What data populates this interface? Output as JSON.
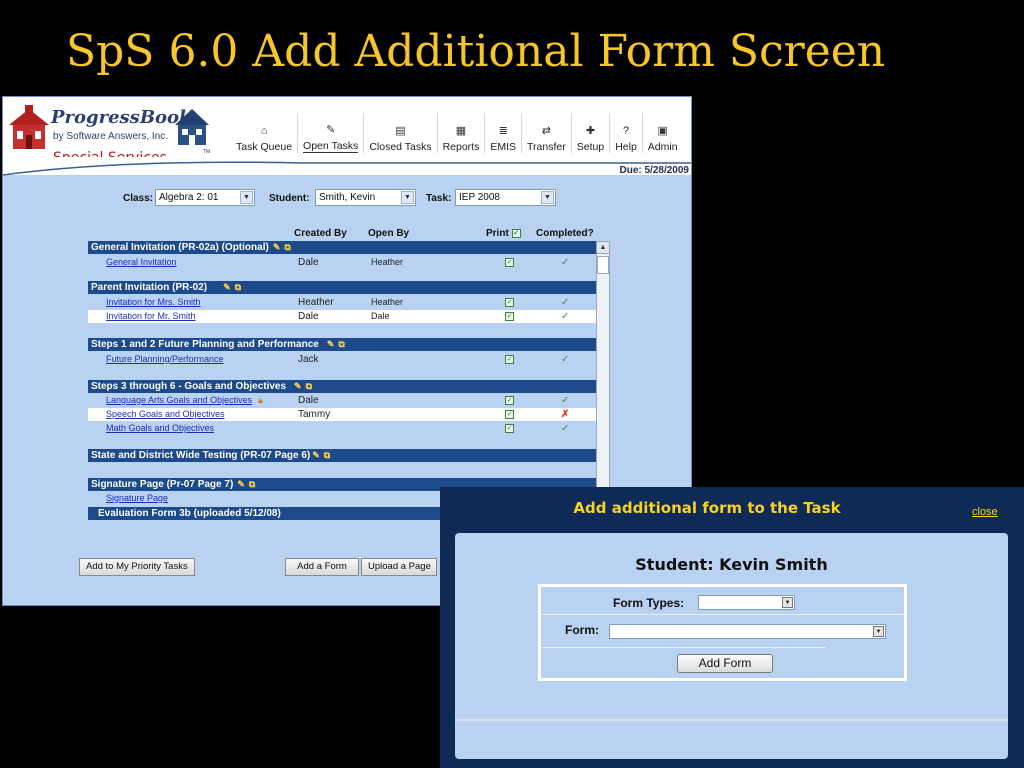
{
  "slide": {
    "title": "SpS 6.0 Add Additional Form Screen"
  },
  "app": {
    "logo": {
      "name": "ProgressBook",
      "sub": "by Software Answers, Inc.",
      "module": "Special Services",
      "tm": "TM"
    },
    "toolbar": [
      {
        "label": "Task Queue",
        "icon": "home-icon",
        "glyph": "⌂"
      },
      {
        "label": "Open Tasks",
        "icon": "edit-icon",
        "glyph": "✎"
      },
      {
        "label": "Closed Tasks",
        "icon": "closed-tasks-icon",
        "glyph": "▤"
      },
      {
        "label": "Reports",
        "icon": "reports-icon",
        "glyph": "▦"
      },
      {
        "label": "EMIS",
        "icon": "emis-icon",
        "glyph": "≣"
      },
      {
        "label": "Transfer",
        "icon": "transfer-icon",
        "glyph": "⇄"
      },
      {
        "label": "Setup",
        "icon": "setup-icon",
        "glyph": "✚"
      },
      {
        "label": "Help",
        "icon": "help-icon",
        "glyph": "?"
      },
      {
        "label": "Admin",
        "icon": "admin-icon",
        "glyph": "▣"
      }
    ],
    "due": "Due: 5/28/2009",
    "filters": {
      "class_label": "Class:",
      "class_value": "Algebra 2: 01",
      "student_label": "Student:",
      "student_value": "Smith, Kevin",
      "task_label": "Task:",
      "task_value": "IEP 2008"
    },
    "columns": {
      "created_by": "Created By",
      "open_by": "Open By",
      "print": "Print",
      "completed": "Completed?"
    },
    "sections": [
      {
        "title": "General Invitation (PR-02a)  (Optional)",
        "rows": [
          {
            "name": "General Invitation",
            "created_by": "Dale",
            "open_by": "Heather",
            "printed": true,
            "completed": "✓"
          }
        ]
      },
      {
        "title": "Parent Invitation (PR-02)",
        "rows": [
          {
            "name": "Invitation for Mrs. Smith",
            "created_by": "Heather",
            "open_by": "Heather",
            "printed": true,
            "completed": "✓"
          },
          {
            "name": "Invitation for Mr. Smith",
            "created_by": "Dale",
            "open_by": "Dale",
            "printed": true,
            "completed": "✓"
          }
        ]
      },
      {
        "title": "Steps 1 and 2 Future Planning and Performance",
        "rows": [
          {
            "name": "Future Planning/Performance",
            "created_by": "Jack",
            "open_by": "",
            "printed": true,
            "completed": "✓"
          }
        ]
      },
      {
        "title": "Steps 3 through 6 - Goals and Objectives",
        "rows": [
          {
            "name": "Language Arts Goals and Objectives",
            "created_by": "Dale",
            "open_by": "",
            "printed": true,
            "completed": "✓"
          },
          {
            "name": "Speech Goals and Objectives",
            "created_by": "Tammy",
            "open_by": "",
            "printed": true,
            "completed": "✗"
          },
          {
            "name": "Math Goals and Objectives",
            "created_by": "",
            "open_by": "",
            "printed": true,
            "completed": "✓"
          }
        ]
      },
      {
        "title": "State and District Wide Testing (PR-07 Page 6)",
        "rows": []
      },
      {
        "title": "Signature Page (Pr-07 Page 7)",
        "rows": [
          {
            "name": "Signature Page",
            "created_by": "",
            "open_by": "",
            "printed": false,
            "completed": ""
          }
        ]
      },
      {
        "title": "Evaluation Form 3b (uploaded 5/12/08)",
        "rows": []
      }
    ],
    "buttons": {
      "priority": "Add to My Priority Tasks",
      "add_form": "Add a Form",
      "upload": "Upload a Page"
    }
  },
  "dialog": {
    "title": "Add additional form  to the Task",
    "close": "close",
    "student": "Student: Kevin Smith",
    "form_types_label": "Form Types:",
    "form_types_value": "",
    "form_label": "Form:",
    "form_value": "",
    "add_button": "Add Form"
  }
}
